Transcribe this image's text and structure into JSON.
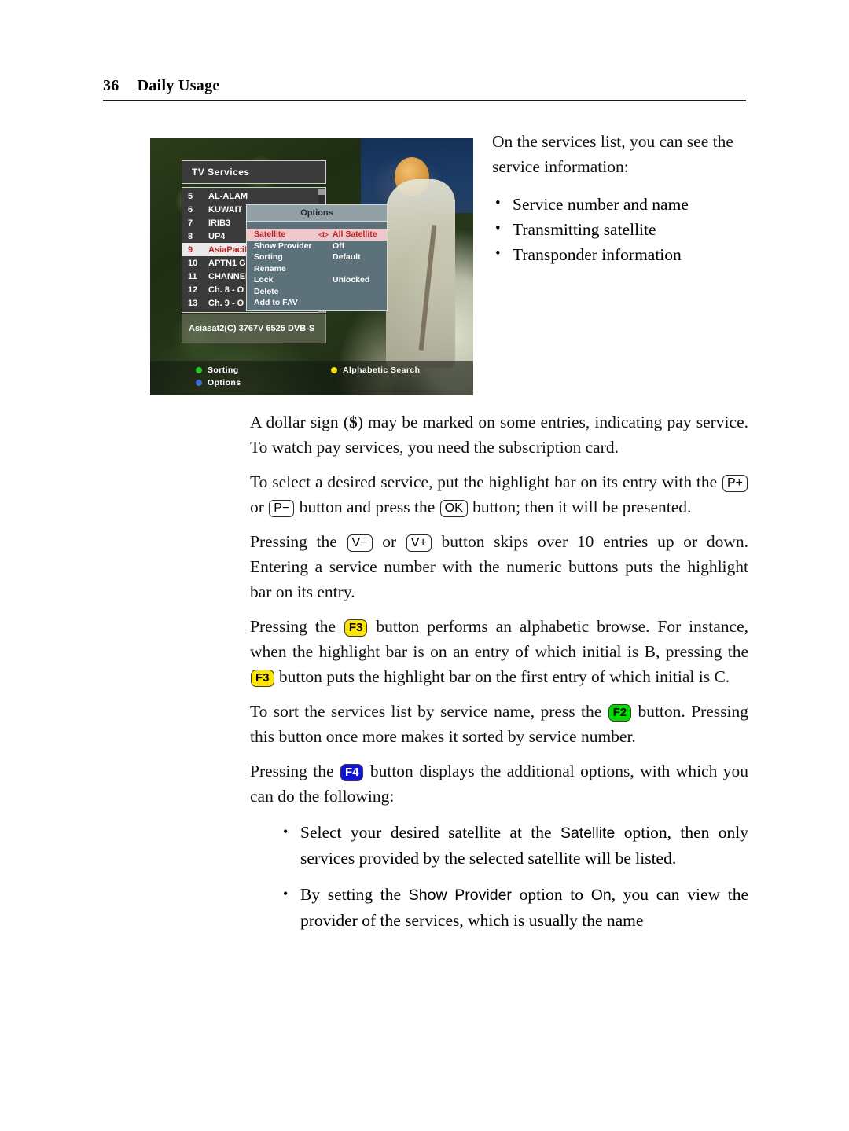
{
  "page": {
    "number": "36",
    "chapter": "Daily Usage"
  },
  "figure": {
    "osd": {
      "window_title": "TV Services",
      "services": [
        {
          "number": "5",
          "name": "AL-ALAM",
          "selected": false
        },
        {
          "number": "6",
          "name": "KUWAIT",
          "selected": false
        },
        {
          "number": "7",
          "name": "IRIB3",
          "selected": false
        },
        {
          "number": "8",
          "name": "UP4",
          "selected": false
        },
        {
          "number": "9",
          "name": "AsiaPacif",
          "selected": true
        },
        {
          "number": "10",
          "name": "APTN1 G",
          "selected": false
        },
        {
          "number": "11",
          "name": "CHANNEL",
          "selected": false
        },
        {
          "number": "12",
          "name": "Ch. 8 - O",
          "selected": false
        },
        {
          "number": "13",
          "name": "Ch. 9 - O",
          "selected": false
        }
      ],
      "info_bar": "Asiasat2(C)   3767V 6525 DVB-S",
      "options_dialog": {
        "title": "Options",
        "rows": [
          {
            "label": "Satellite",
            "arrows": "◁▷",
            "value": "All Satellite",
            "highlighted": true
          },
          {
            "label": "Show Provider",
            "arrows": "",
            "value": "Off",
            "highlighted": false
          },
          {
            "label": "Sorting",
            "arrows": "",
            "value": "Default",
            "highlighted": false
          },
          {
            "label": "Rename",
            "arrows": "",
            "value": "",
            "highlighted": false
          },
          {
            "label": "Lock",
            "arrows": "",
            "value": "Unlocked",
            "highlighted": false
          },
          {
            "label": "Delete",
            "arrows": "",
            "value": "",
            "highlighted": false
          },
          {
            "label": "Add to FAV",
            "arrows": "",
            "value": "",
            "highlighted": false
          }
        ]
      },
      "legend": [
        {
          "label": "Sorting",
          "color": "#22cc22"
        },
        {
          "label": "Options",
          "color": "#3a6fd8"
        },
        {
          "label": "Alphabetic Search",
          "color": "#e8e000"
        }
      ]
    }
  },
  "content": {
    "intro_lead": "On the services list, you can see the service information:",
    "intro_bullets": [
      "Service number and name",
      "Transmitting satellite",
      "Transponder information"
    ],
    "para_dollar_1": "A dollar sign (",
    "para_dollar_symbol": "$",
    "para_dollar_2": ") may be marked on some entries, indicating pay service. To watch pay services, you need the subscription card.",
    "para_select_1": "To select a desired service, put the highlight bar on its entry with the ",
    "key_pplus": "P+",
    "para_select_2": " or ",
    "key_pminus": "P−",
    "para_select_3": " button and press the ",
    "key_ok": "OK",
    "para_select_4": " button; then it will be presented.",
    "para_skip_1": "Pressing the ",
    "key_vminus": "V−",
    "para_skip_2": " or ",
    "key_vplus": "V+",
    "para_skip_3": " button skips over 10 entries up or down. Entering a service number with the numeric buttons puts the highlight bar on its entry.",
    "para_f3_1": "Pressing the ",
    "key_f3": "F3",
    "para_f3_2": " button performs an alphabetic browse. For instance, when the highlight bar is on an entry of which initial is B, pressing the ",
    "para_f3_3": " button puts the highlight bar on the first entry of which initial is C.",
    "para_f2_1": "To sort the services list by service name, press the ",
    "key_f2": "F2",
    "para_f2_2": " button. Pressing this button once more makes it sorted by service number.",
    "para_f4_1": "Pressing the ",
    "key_f4": "F4",
    "para_f4_2": " button displays the additional options, with which you can do the following:",
    "opt_bullet_1a": "Select your desired satellite at the ",
    "opt_bullet_1_term": "Satellite",
    "opt_bullet_1b": " option, then only services provided by the selected satellite will be listed.",
    "opt_bullet_2a": "By setting the ",
    "opt_bullet_2_term1": "Show Provider",
    "opt_bullet_2b": " option to ",
    "opt_bullet_2_term2": "On",
    "opt_bullet_2c": ", you can view the provider of the services, which is usually the name"
  }
}
